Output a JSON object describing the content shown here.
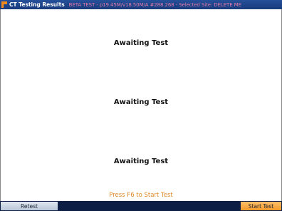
{
  "titlebar": {
    "icon": "app-logo-icon",
    "title": "CT Testing Results",
    "info": "BETA TEST - p19.45M/v18.50M/A #288.268 - Selected Site: DELETE ME"
  },
  "main": {
    "status_1": "Awaiting Test",
    "status_2": "Awaiting Test",
    "status_3": "Awaiting Test",
    "hint": "Press F6 to Start Test"
  },
  "toolbar": {
    "retest_label": "Retest",
    "start_label": "Start Test"
  },
  "colors": {
    "titlebar": "#1f4a8e",
    "hint": "#e08a28",
    "start_button": "#f5a23a",
    "bottom_bar": "#0c1e44"
  }
}
